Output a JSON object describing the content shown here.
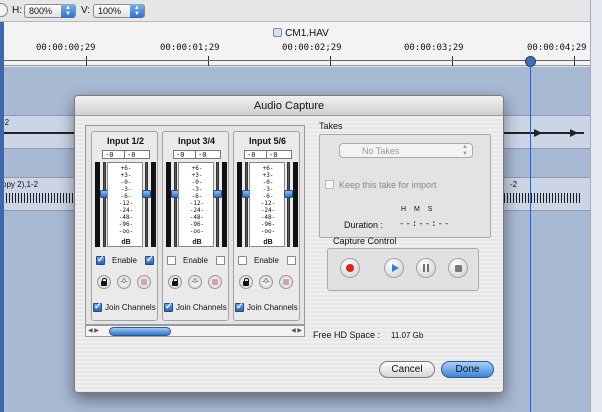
{
  "zoombar": {
    "h_label": "H:",
    "h_value": "800%",
    "v_label": "V:",
    "v_value": "100%"
  },
  "timeline": {
    "file_title": "CM1.HAV",
    "timecodes": [
      "00:00:00;29",
      "00:00:01;29",
      "00:00:02;29",
      "00:00:03;29",
      "00:00:04;29"
    ],
    "track_labels": [
      "-2",
      "opy 2),1-2",
      "-2"
    ]
  },
  "dialog": {
    "title": "Audio Capture",
    "channels": [
      {
        "title": "Input 1/2",
        "peak_left": "-0",
        "peak_right": "-0",
        "enable_left_checked": true,
        "enable_right_checked": true,
        "join_checked": true
      },
      {
        "title": "Input 3/4",
        "peak_left": "-0",
        "peak_right": "-0",
        "enable_left_checked": false,
        "enable_right_checked": false,
        "join_checked": true
      },
      {
        "title": "Input 5/6",
        "peak_left": "-0",
        "peak_right": "-0",
        "enable_left_checked": false,
        "enable_right_checked": false,
        "join_checked": true
      }
    ],
    "meter_scale": [
      "+6-",
      "+3-",
      "-0-",
      "-3-",
      "-6-",
      "-12-",
      "-24-",
      "-48-",
      "-96-",
      "-oo-"
    ],
    "meter_unit": "dB",
    "enable_label": "Enable",
    "join_label": "Join Channels",
    "takes": {
      "label": "Takes",
      "selected": "No Takes",
      "keep_label": "Keep this take for import",
      "keep_checked": false,
      "hms_header": "H  M  S",
      "duration_label": "Duration :",
      "duration_value": "--:--:--"
    },
    "capture": {
      "label": "Capture Control",
      "buttons": [
        "record",
        "play",
        "pause",
        "stop"
      ]
    },
    "free_space_label": "Free HD Space :",
    "free_space_value": "11.07 Gb",
    "cancel_label": "Cancel",
    "done_label": "Done"
  },
  "colors": {
    "accent_blue": "#3f84d8",
    "record_red": "#e0201a",
    "track_bg": "#cbd5e6"
  }
}
